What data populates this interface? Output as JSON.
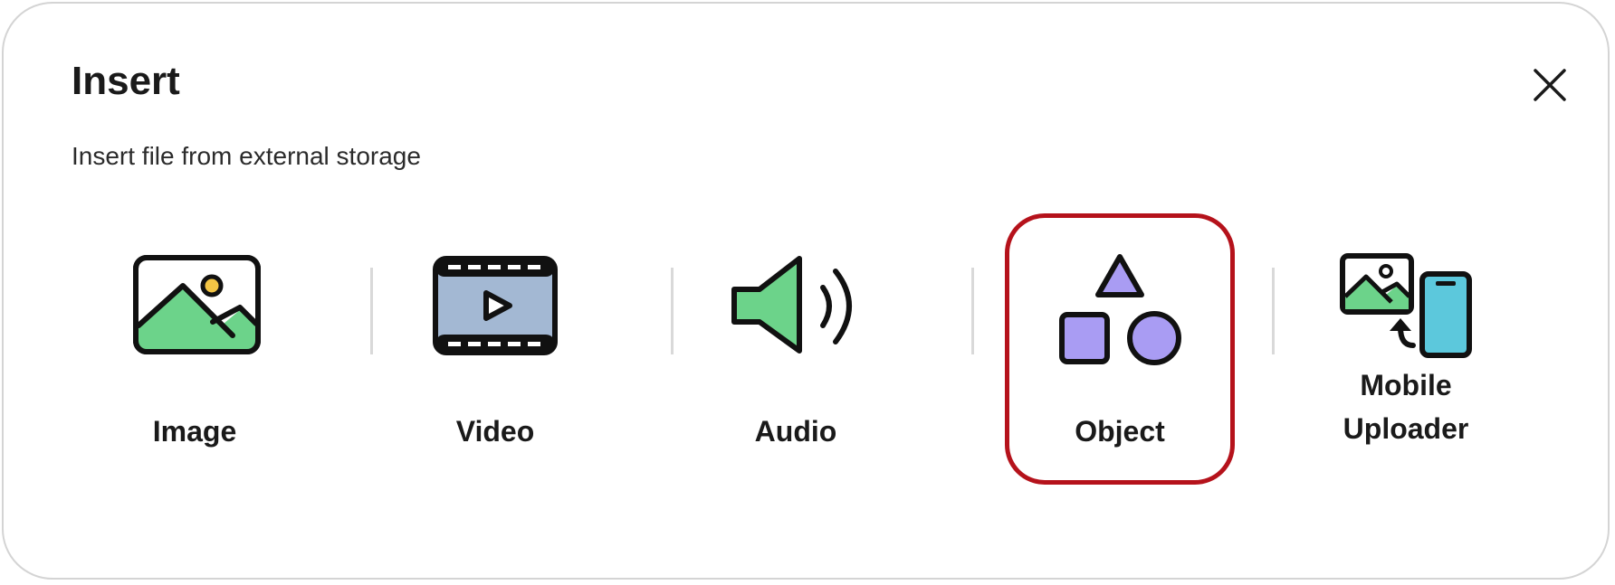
{
  "dialog": {
    "title": "Insert",
    "subtitle": "Insert file from external storage",
    "close_icon": "close-icon"
  },
  "options": [
    {
      "label": "Image",
      "icon": "image-icon"
    },
    {
      "label": "Video",
      "icon": "video-icon"
    },
    {
      "label": "Audio",
      "icon": "audio-icon"
    },
    {
      "label": "Object",
      "icon": "object-icon",
      "selected": true
    },
    {
      "label": "Mobile Uploader",
      "icon": "mobile-uploader-icon"
    }
  ],
  "colors": {
    "selection_border": "#b5121b",
    "green": "#6cd38a",
    "video_blue": "#a3b8d3",
    "purple": "#a99cf3",
    "phone_cyan": "#5cc8dc",
    "sun_yellow": "#f3c545"
  }
}
